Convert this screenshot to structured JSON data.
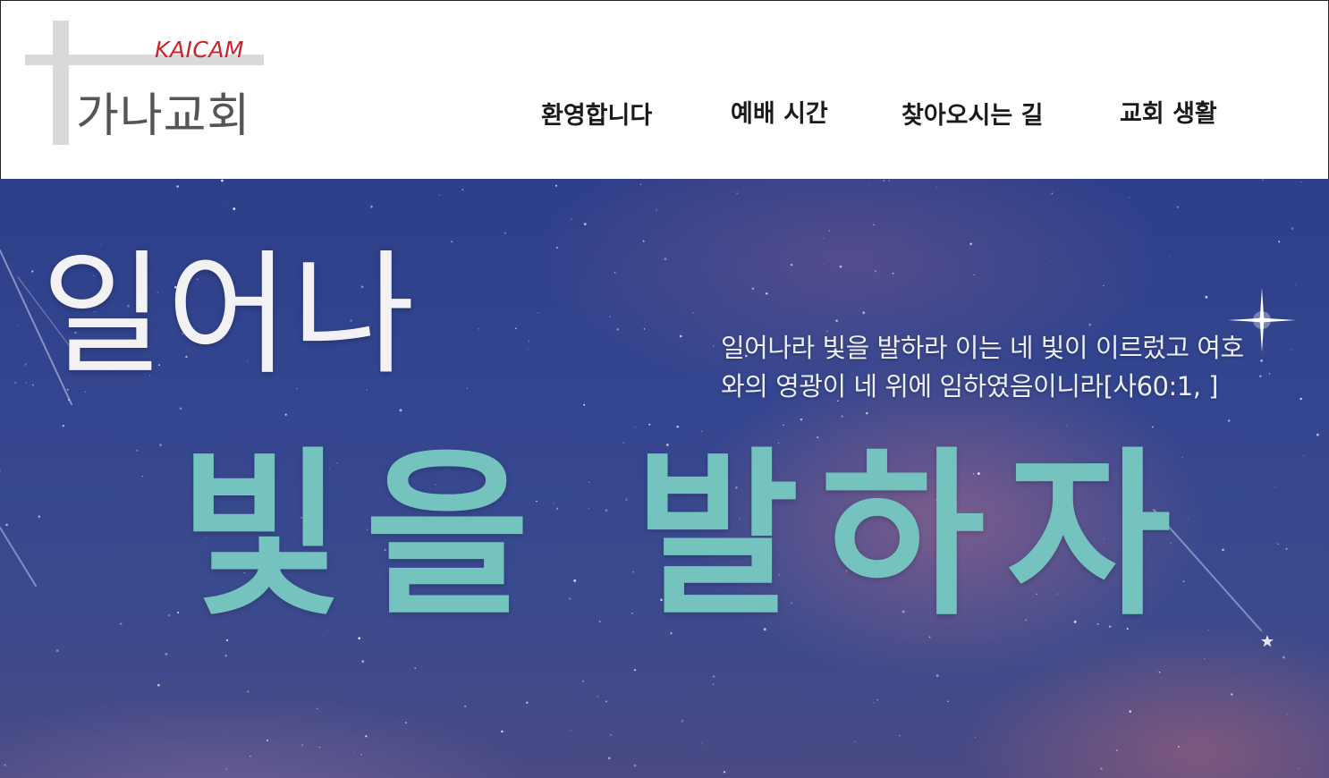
{
  "header": {
    "logo_sub": "KAICAM",
    "logo_title": "가나교회",
    "nav": [
      {
        "label": "환영합니다"
      },
      {
        "label": "예배 시간"
      },
      {
        "label": "찾아오시는 길"
      },
      {
        "label": "교회 생활"
      }
    ]
  },
  "hero": {
    "headline_line1": "일어나",
    "headline_line2": "빛을 발하자",
    "verse_line1": "일어나라 빛을 발하라 이는 네 빛이 이르렀고 여호",
    "verse_line2": "와의 영광이 네 위에 임하였음이니라[사60:1, ]"
  },
  "colors": {
    "logo_sub": "#c9262c",
    "cross": "#d9d9d9",
    "headline_line1": "#f2f2f4",
    "headline_line2": "#74c3bf",
    "sky_top": "#2e3f8a",
    "sky_bottom": "#4a4a84"
  },
  "icons": [
    "cross-logo-icon",
    "sparkle-star-icon",
    "small-star-icon"
  ]
}
